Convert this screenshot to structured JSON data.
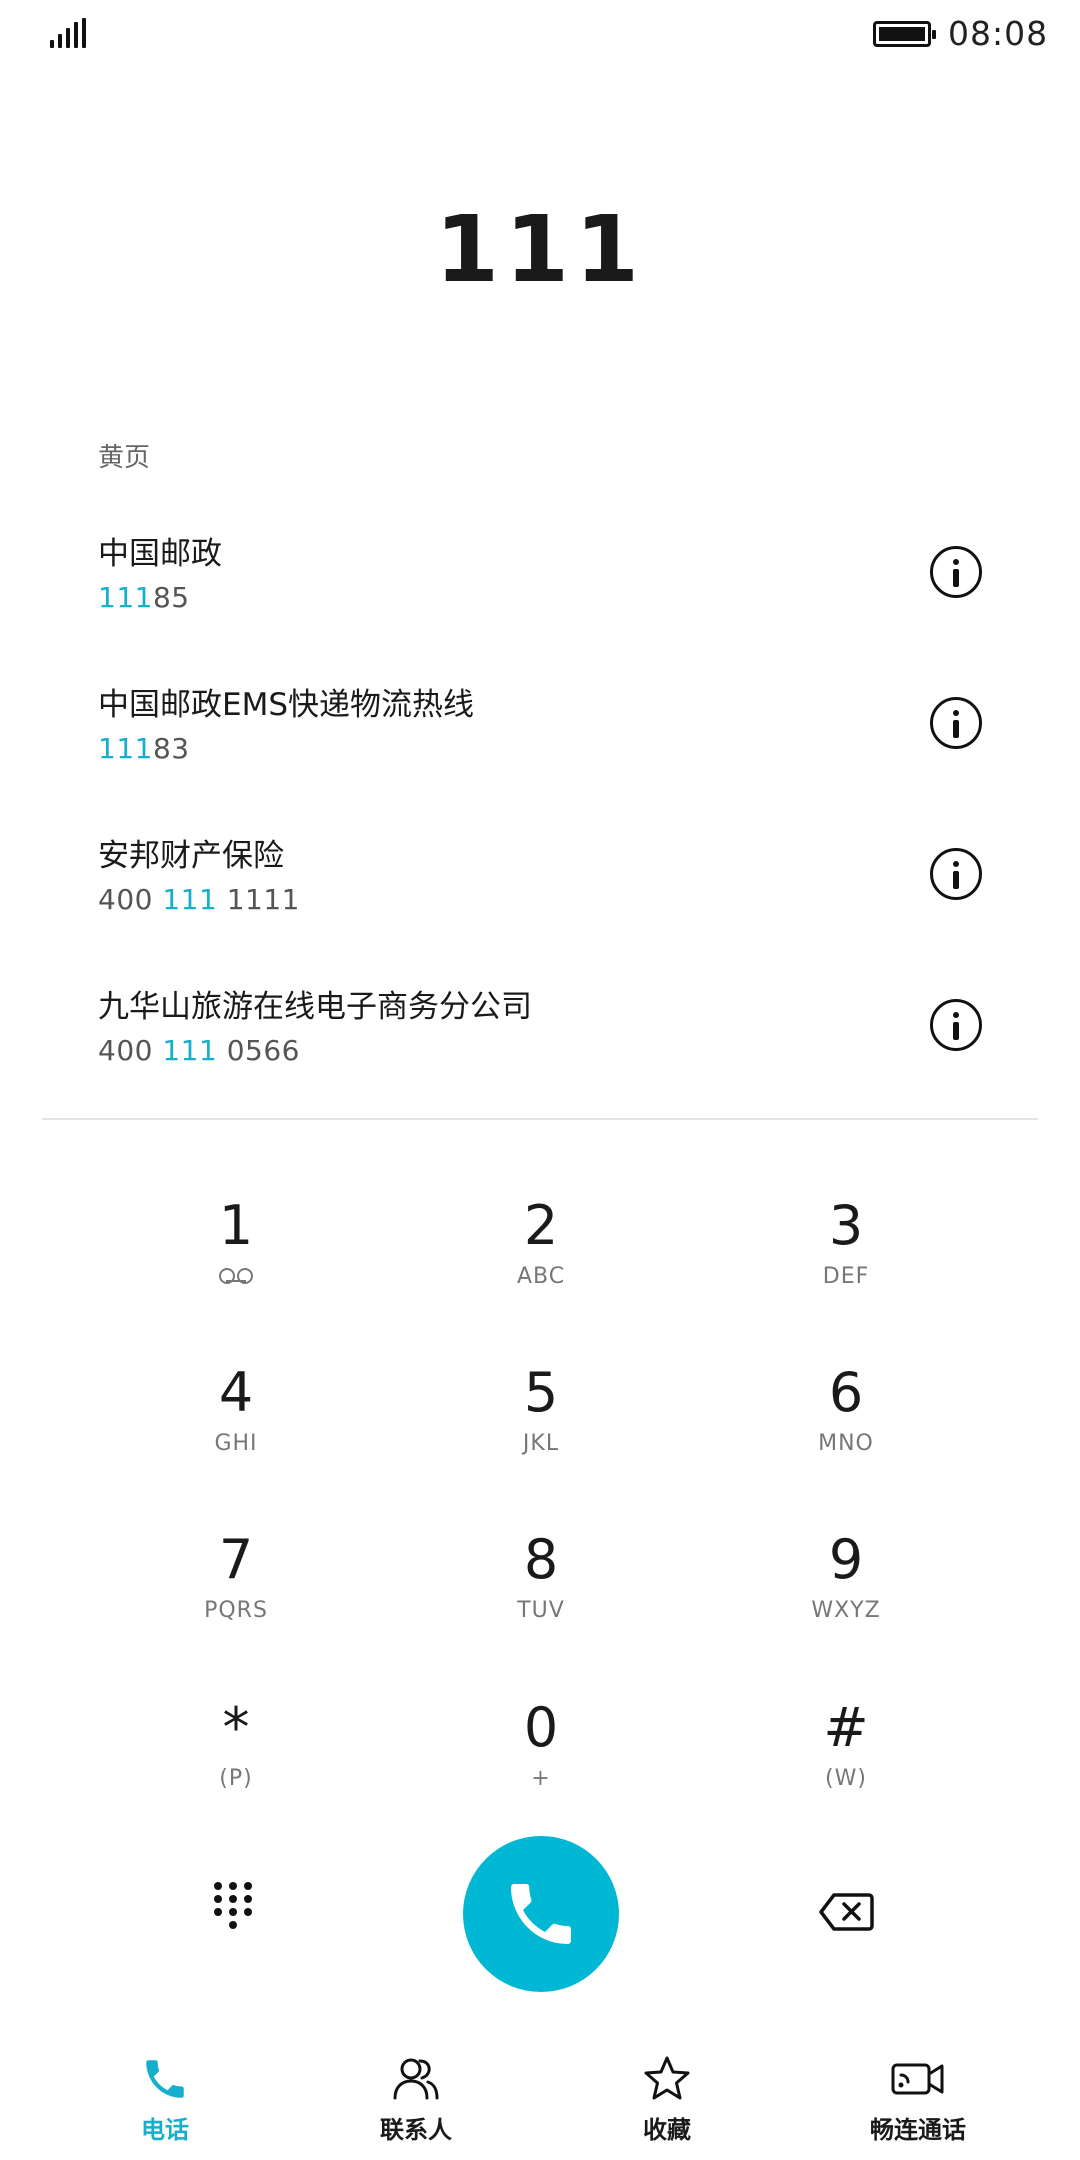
{
  "status_bar": {
    "time": "08:08",
    "signal_icon": "signal-icon",
    "battery_icon": "battery-icon"
  },
  "dialer": {
    "number": "111"
  },
  "yellow_pages": {
    "header": "黄页",
    "results": [
      {
        "name": "中国邮政",
        "number_highlight": "111",
        "number_rest": "85",
        "number_prefix": ""
      },
      {
        "name": "中国邮政EMS快递物流热线",
        "number_highlight": "111",
        "number_rest": "83",
        "number_prefix": ""
      },
      {
        "name": "安邦财产保险",
        "number_prefix": "400 ",
        "number_highlight": "111",
        "number_rest": " 1111"
      },
      {
        "name": "九华山旅游在线电子商务分公司",
        "number_prefix": "400 ",
        "number_highlight": "111",
        "number_rest": " 0566"
      }
    ]
  },
  "keypad": {
    "keys": [
      {
        "digit": "1",
        "letters": ""
      },
      {
        "digit": "2",
        "letters": "ABC"
      },
      {
        "digit": "3",
        "letters": "DEF"
      },
      {
        "digit": "4",
        "letters": "GHI"
      },
      {
        "digit": "5",
        "letters": "JKL"
      },
      {
        "digit": "6",
        "letters": "MNO"
      },
      {
        "digit": "7",
        "letters": "PQRS"
      },
      {
        "digit": "8",
        "letters": "TUV"
      },
      {
        "digit": "9",
        "letters": "WXYZ"
      },
      {
        "digit": "*",
        "letters": "(P)"
      },
      {
        "digit": "0",
        "letters": "+"
      },
      {
        "digit": "#",
        "letters": "(W)"
      }
    ]
  },
  "actions": {
    "dialpad_icon": "dialpad-icon",
    "call_icon": "phone-icon",
    "backspace_icon": "backspace-icon"
  },
  "bottom_nav": {
    "items": [
      {
        "label": "电话",
        "icon": "phone-icon",
        "active": true
      },
      {
        "label": "联系人",
        "icon": "contacts-icon",
        "active": false
      },
      {
        "label": "收藏",
        "icon": "star-icon",
        "active": false
      },
      {
        "label": "畅连通话",
        "icon": "video-call-icon",
        "active": false
      }
    ]
  },
  "colors": {
    "accent": "#15afcd",
    "call_button": "#00b8d4",
    "text": "#1a1a1a",
    "secondary": "#666666"
  }
}
